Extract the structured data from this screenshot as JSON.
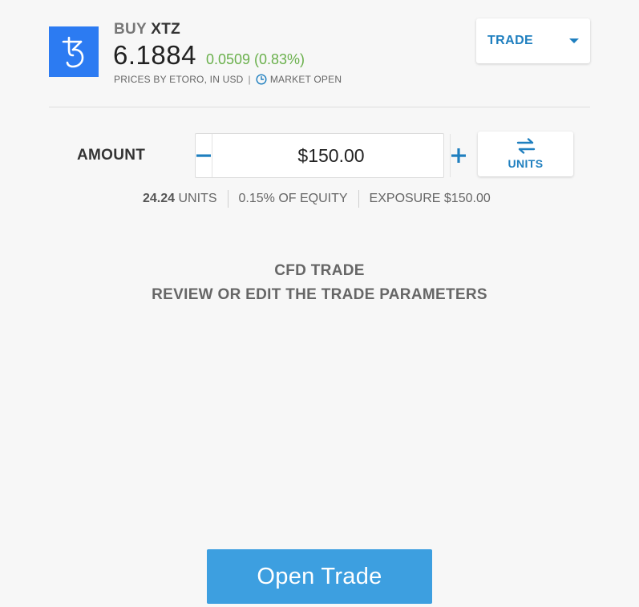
{
  "asset": {
    "icon": "tezos-icon",
    "action": "BUY",
    "symbol": "XTZ",
    "price": "6.1884",
    "change": "0.0509 (0.83%)",
    "price_source": "PRICES BY ETORO, IN USD",
    "separator": "|",
    "market_status": "MARKET OPEN"
  },
  "trade_dropdown": {
    "label": "TRADE"
  },
  "amount": {
    "label": "AMOUNT",
    "value": "$150.00",
    "minus_icon": "minus-icon",
    "plus_icon": "plus-icon"
  },
  "units_toggle": {
    "label": "UNITS",
    "icon": "swap-arrows-icon"
  },
  "amount_info": {
    "units_value": "24.24",
    "units_label": "UNITS",
    "equity": "0.15% OF EQUITY",
    "exposure": "EXPOSURE $150.00"
  },
  "cfd": {
    "title": "CFD TRADE",
    "subtitle": "REVIEW OR EDIT THE TRADE PARAMETERS"
  },
  "open_trade": {
    "label": "Open Trade"
  },
  "colors": {
    "accent": "#1f7fbf",
    "button": "#3d9fe0",
    "positive": "#6ab04c",
    "logo_bg": "#2c7bf2"
  }
}
